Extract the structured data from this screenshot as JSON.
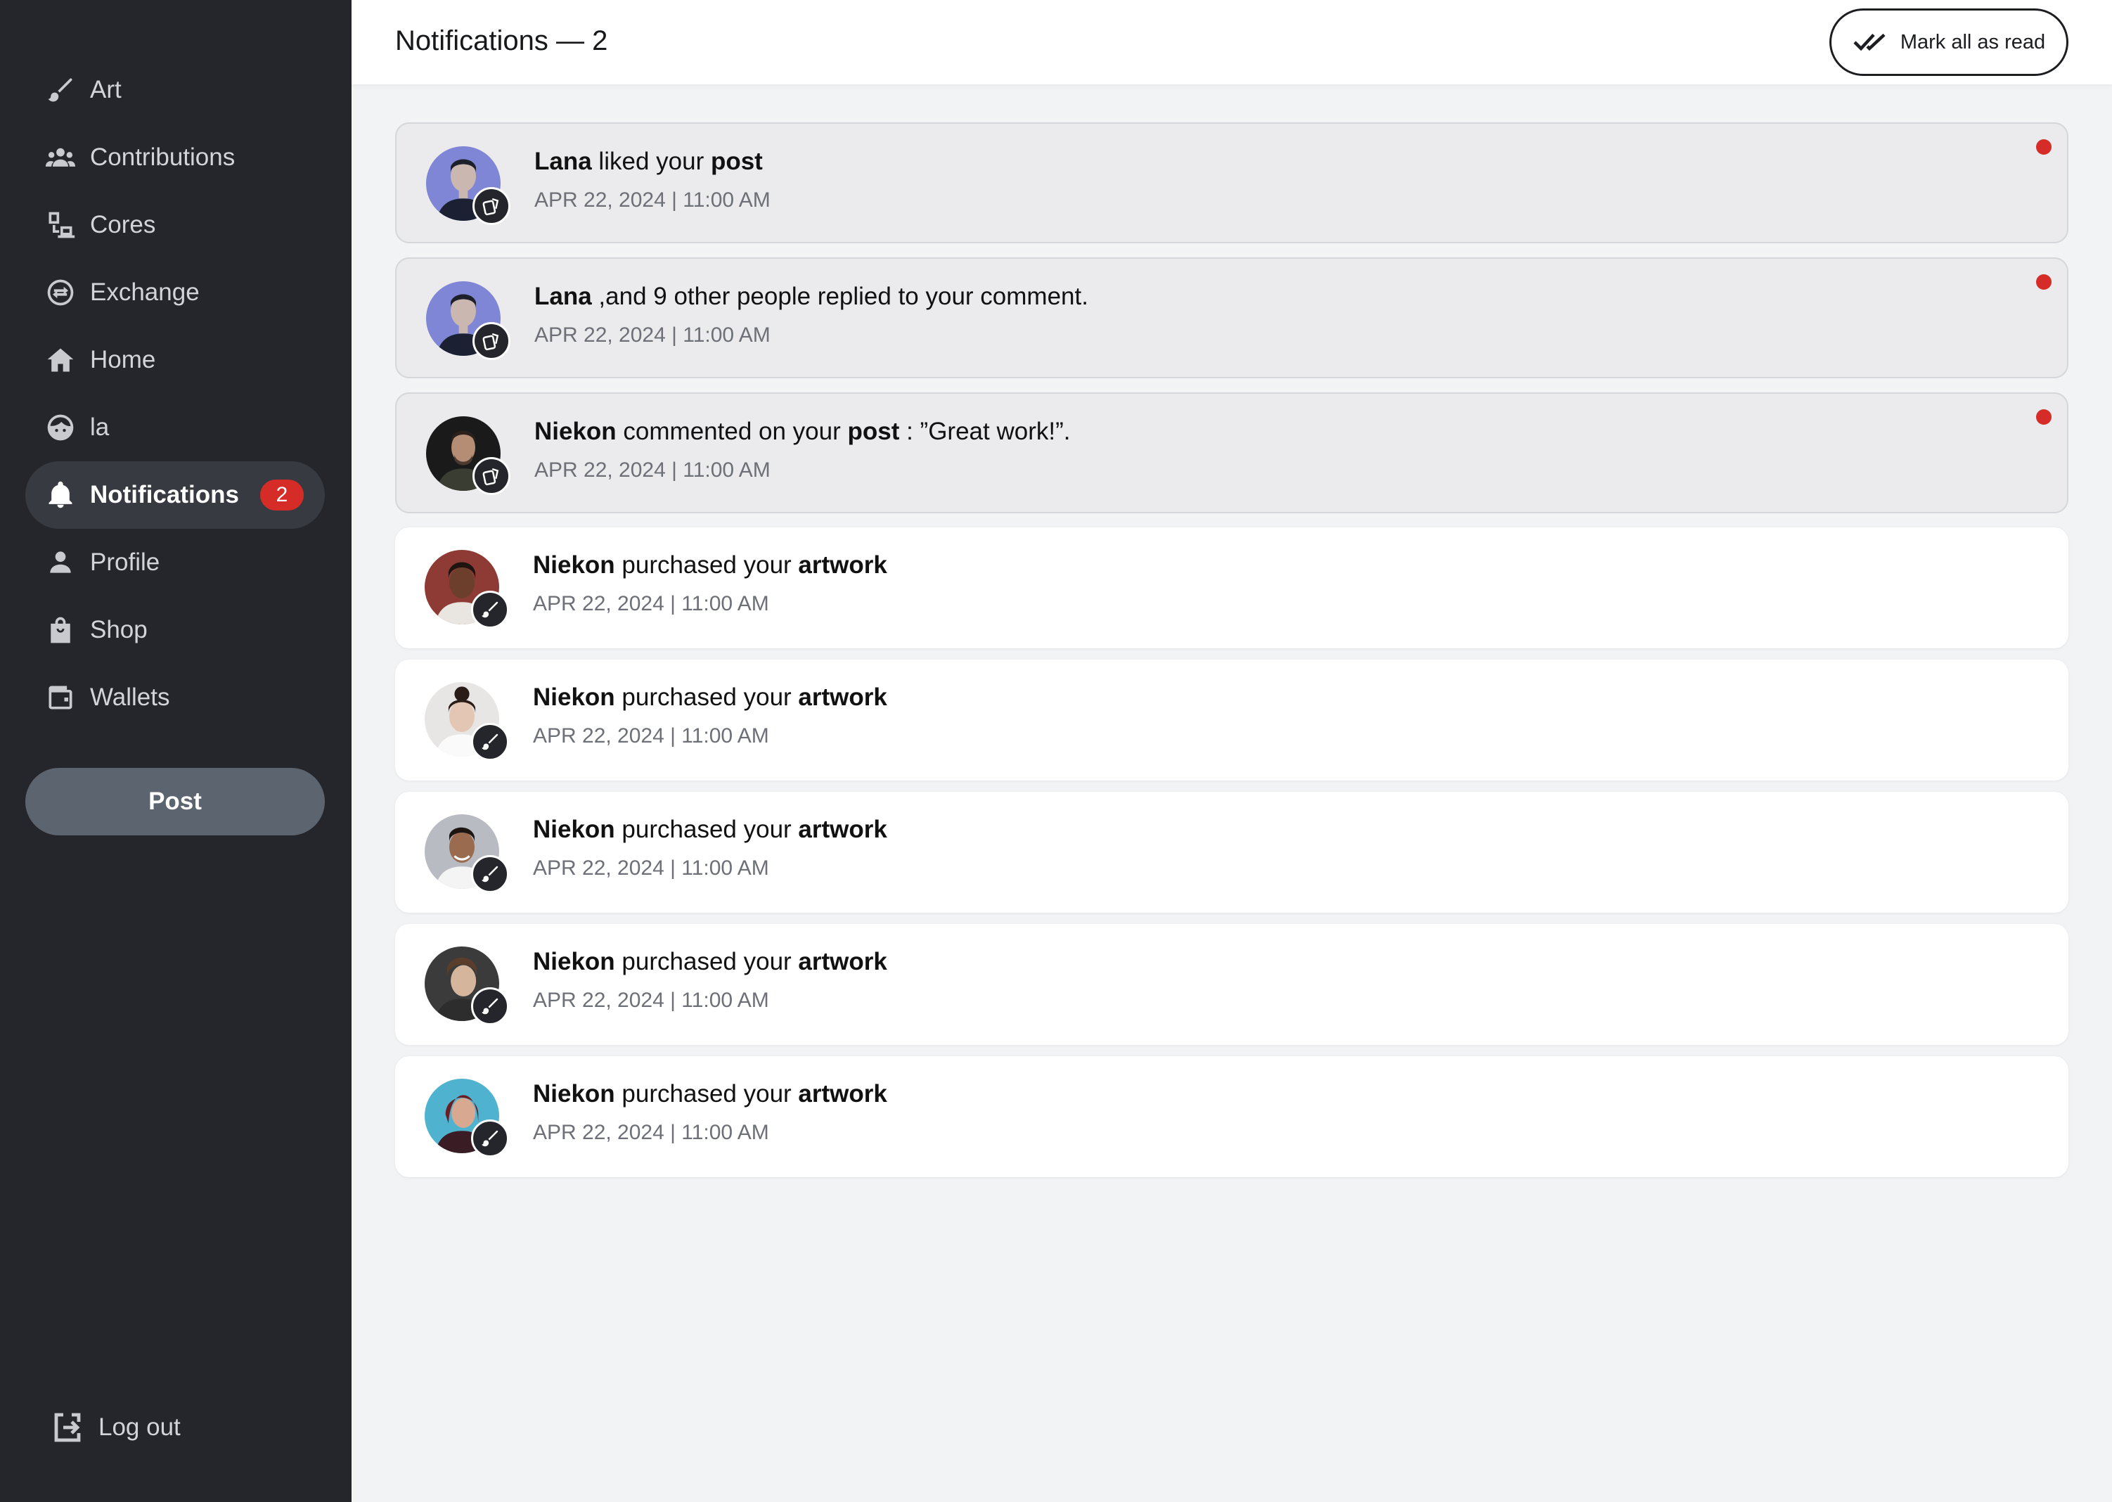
{
  "sidebar": {
    "items": [
      {
        "label": "Art",
        "icon": "brush-icon"
      },
      {
        "label": "Contributions",
        "icon": "people-icon"
      },
      {
        "label": "Cores",
        "icon": "devices-icon"
      },
      {
        "label": "Exchange",
        "icon": "exchange-icon"
      },
      {
        "label": "Home",
        "icon": "home-icon"
      },
      {
        "label": "la",
        "icon": "face-icon"
      },
      {
        "label": "Notifications",
        "icon": "bell-icon",
        "badge": "2",
        "active": true
      },
      {
        "label": "Profile",
        "icon": "person-icon"
      },
      {
        "label": "Shop",
        "icon": "bag-icon"
      },
      {
        "label": "Wallets",
        "icon": "wallet-icon"
      }
    ],
    "post_label": "Post",
    "logout_label": "Log out"
  },
  "header": {
    "title": "Notifications — 2",
    "mark_all_label": "Mark all as read"
  },
  "notifications": [
    {
      "actor": "Lana",
      "text": " liked your ",
      "object": "post",
      "suffix": "",
      "time": "APR 22, 2024 | 11:00 AM",
      "unread": true,
      "badge_icon": "cards-icon"
    },
    {
      "actor": "Lana",
      "text": " ,and 9 other people replied to your comment.",
      "object": "",
      "suffix": "",
      "time": "APR 22, 2024 | 11:00 AM",
      "unread": true,
      "badge_icon": "cards-icon"
    },
    {
      "actor": "Niekon",
      "text": " commented on your ",
      "object": "post",
      "suffix": " : ”Great work!”.",
      "time": "APR 22, 2024 | 11:00 AM",
      "unread": true,
      "badge_icon": "cards-icon"
    },
    {
      "actor": "Niekon",
      "text": " purchased your ",
      "object": "artwork",
      "suffix": "",
      "time": "APR 22, 2024 | 11:00 AM",
      "unread": false,
      "badge_icon": "brush-icon"
    },
    {
      "actor": "Niekon",
      "text": " purchased your ",
      "object": "artwork",
      "suffix": "",
      "time": "APR 22, 2024 | 11:00 AM",
      "unread": false,
      "badge_icon": "brush-icon"
    },
    {
      "actor": "Niekon",
      "text": " purchased your ",
      "object": "artwork",
      "suffix": "",
      "time": "APR 22, 2024 | 11:00 AM",
      "unread": false,
      "badge_icon": "brush-icon"
    },
    {
      "actor": "Niekon",
      "text": " purchased your ",
      "object": "artwork",
      "suffix": "",
      "time": "APR 22, 2024 | 11:00 AM",
      "unread": false,
      "badge_icon": "brush-icon"
    },
    {
      "actor": "Niekon",
      "text": " purchased your ",
      "object": "artwork",
      "suffix": "",
      "time": "APR 22, 2024 | 11:00 AM",
      "unread": false,
      "badge_icon": "brush-icon"
    }
  ],
  "colors": {
    "sidebar_bg": "#24262b",
    "active_item_bg": "#373a40",
    "badge_red": "#d52c28",
    "post_button_bg": "#5c6470",
    "unread_card_bg": "#ebebed",
    "page_bg": "#f2f3f5"
  }
}
